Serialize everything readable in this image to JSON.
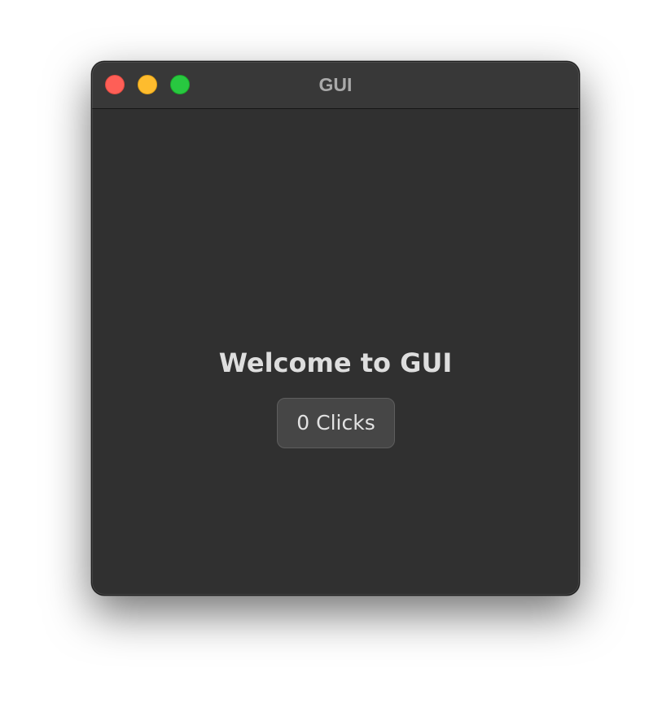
{
  "window": {
    "title": "GUI",
    "controls": {
      "close_color": "#fe5f57",
      "minimize_color": "#febc2e",
      "zoom_color": "#28c840"
    }
  },
  "main": {
    "heading": "Welcome to GUI",
    "click_button_label": "0 Clicks"
  }
}
